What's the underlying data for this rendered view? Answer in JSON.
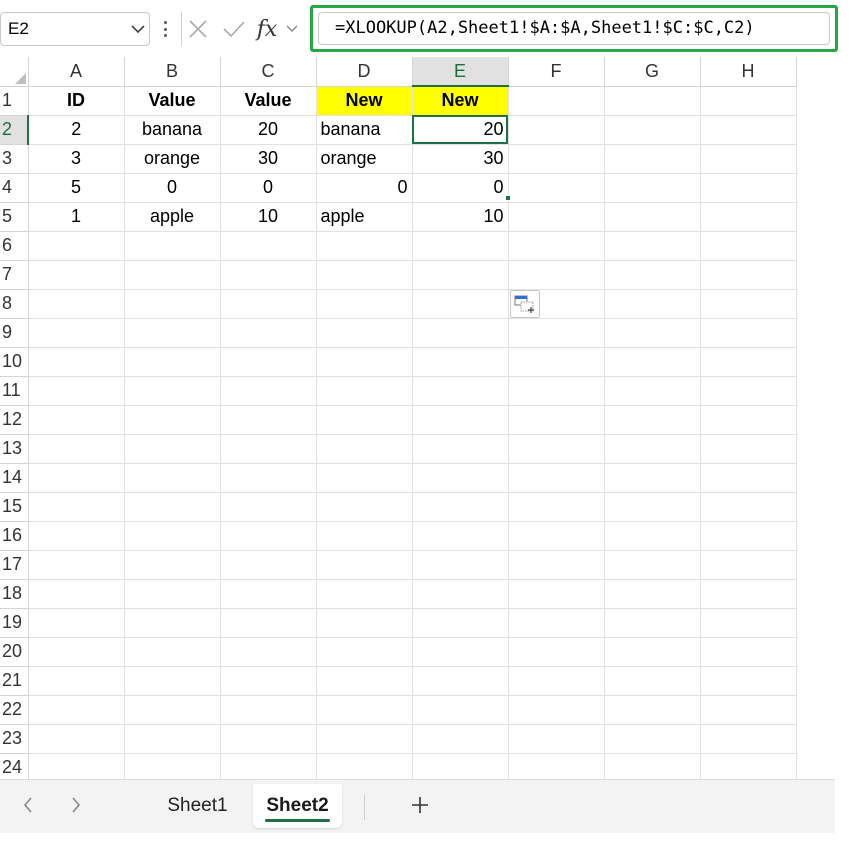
{
  "formula_bar": {
    "name_box": "E2",
    "formula": "=XLOOKUP(A2,Sheet1!$A:$A,Sheet1!$C:$C,C2)",
    "fx_label": "fx"
  },
  "grid": {
    "columns": [
      "A",
      "B",
      "C",
      "D",
      "E",
      "F",
      "G",
      "H"
    ],
    "rows": [
      "1",
      "2",
      "3",
      "4",
      "5",
      "6",
      "7",
      "8",
      "9",
      "10",
      "11",
      "12",
      "13",
      "14",
      "15",
      "16",
      "17",
      "18",
      "19",
      "20",
      "21",
      "22",
      "23",
      "24"
    ],
    "cells": {
      "A1": "ID",
      "B1": "Value",
      "C1": "Value",
      "D1": "New",
      "E1": "New",
      "A2": "2",
      "B2": "banana",
      "C2": "20",
      "D2": "banana",
      "E2": "20",
      "A3": "3",
      "B3": "orange",
      "C3": "30",
      "D3": "orange",
      "E3": "30",
      "A4": "5",
      "B4": "0",
      "C4": "0",
      "D4": "0",
      "E4": "0",
      "A5": "1",
      "B5": "apple",
      "C5": "10",
      "D5": "apple",
      "E5": "10"
    },
    "active_cell": "E2",
    "highlight_color": "#ffff00",
    "accent_color": "#1e7145"
  },
  "tabs": {
    "sheets": [
      "Sheet1",
      "Sheet2"
    ],
    "active": "Sheet2"
  },
  "colors": {
    "formula_highlight_border": "#28a745"
  }
}
